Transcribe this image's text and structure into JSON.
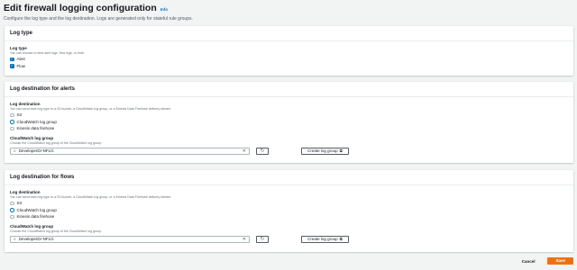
{
  "page": {
    "title": "Edit firewall logging configuration",
    "info_link": "Info",
    "subtitle": "Configure the log type and the log destination. Logs are generated only for stateful rule groups."
  },
  "log_type": {
    "header": "Log type",
    "label": "Log type",
    "description": "You can choose to emit alert logs, flow logs, or both.",
    "options": [
      {
        "label": "Alert",
        "checked": true
      },
      {
        "label": "Flow",
        "checked": true
      }
    ]
  },
  "alerts": {
    "header": "Log destination for alerts",
    "label": "Log destination",
    "description": "You can send each log type to a S3 bucket, a CloudWatch log group, or a Kinesis Data Firehose delivery stream.",
    "options": [
      {
        "label": "S3",
        "selected": false
      },
      {
        "label": "CloudWatch log group",
        "selected": true
      },
      {
        "label": "Kinesis data firehose",
        "selected": false
      }
    ],
    "group_label": "CloudWatch log group",
    "group_description": "Choose the CloudWatch log group of the CloudWatch log group.",
    "group_value": "DeveloperDr-NFLG",
    "create_label": "Create log group"
  },
  "flows": {
    "header": "Log destination for flows",
    "label": "Log destination",
    "description": "You can send each log type to a S3 bucket, a CloudWatch log group, or a Kinesis Data Firehose delivery stream.",
    "options": [
      {
        "label": "S3",
        "selected": false
      },
      {
        "label": "CloudWatch log group",
        "selected": true
      },
      {
        "label": "Kinesis data firehose",
        "selected": false
      }
    ],
    "group_label": "CloudWatch log group",
    "group_description": "Choose the CloudWatch log group of the CloudWatch log group.",
    "group_value": "DeveloperDr-NFLG",
    "create_label": "Create log group"
  },
  "footer": {
    "cancel": "Cancel",
    "save": "Save"
  }
}
